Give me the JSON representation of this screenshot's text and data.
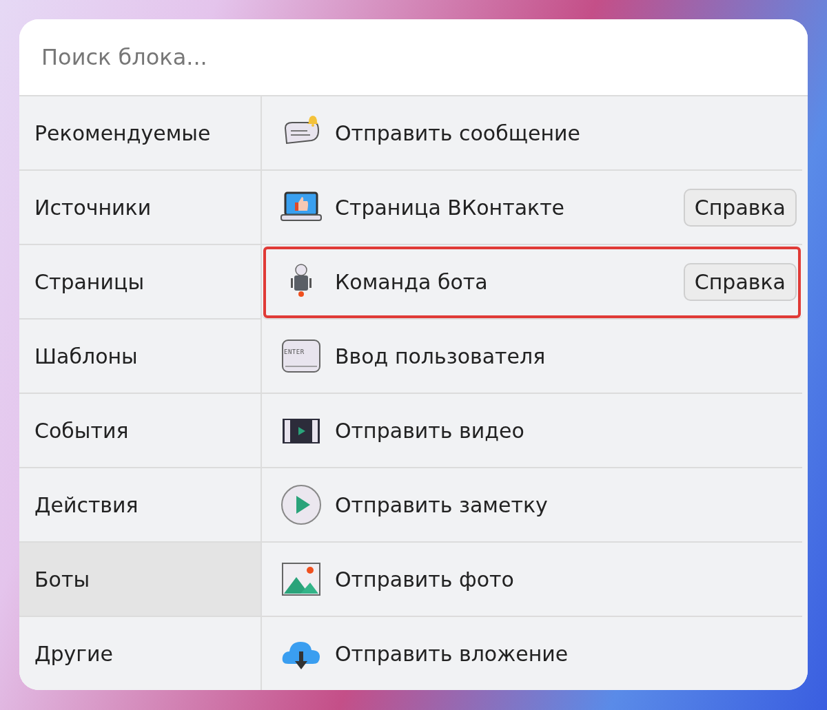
{
  "search": {
    "placeholder": "Поиск блока..."
  },
  "categories": [
    {
      "label": "Рекомендуемые",
      "selected": false
    },
    {
      "label": "Источники",
      "selected": false
    },
    {
      "label": "Страницы",
      "selected": false
    },
    {
      "label": "Шаблоны",
      "selected": false
    },
    {
      "label": "События",
      "selected": false
    },
    {
      "label": "Действия",
      "selected": false
    },
    {
      "label": "Боты",
      "selected": true
    },
    {
      "label": "Другие",
      "selected": false
    }
  ],
  "blocks": [
    {
      "kind": "message",
      "label": "Отправить сообщение",
      "highlighted": false
    },
    {
      "kind": "vk",
      "label": "Страница ВКонтакте",
      "help": "Справка",
      "highlighted": false
    },
    {
      "kind": "robot",
      "label": "Команда бота",
      "help": "Справка",
      "highlighted": true
    },
    {
      "kind": "key",
      "label": "Ввод пользователя",
      "key_label": "ENTER",
      "highlighted": false
    },
    {
      "kind": "video",
      "label": "Отправить видео",
      "highlighted": false
    },
    {
      "kind": "note",
      "label": "Отправить заметку",
      "highlighted": false
    },
    {
      "kind": "photo",
      "label": "Отправить фото",
      "highlighted": false
    },
    {
      "kind": "attachment",
      "label": "Отправить вложение",
      "highlighted": false
    }
  ]
}
